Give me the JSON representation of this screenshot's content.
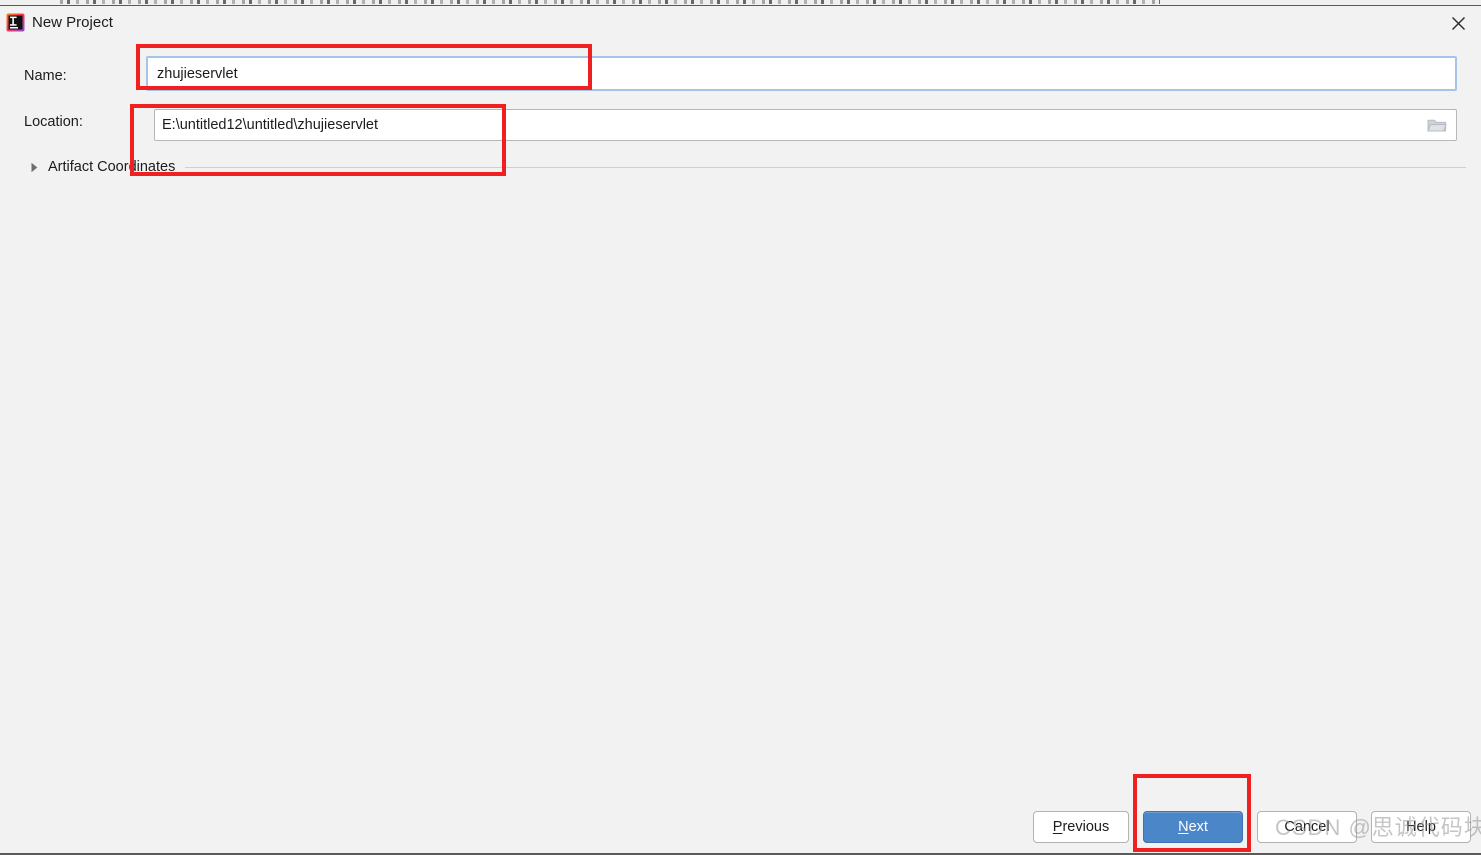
{
  "window": {
    "title": "New Project",
    "icon": "intellij-idea-icon",
    "close_icon": "close-icon"
  },
  "form": {
    "name": {
      "label": "Name:",
      "value": "zhujieservlet",
      "placeholder": "Name"
    },
    "location": {
      "label": "Location:",
      "value": "E:\\untitled12\\untitled\\zhujieservlet",
      "placeholder": "Location",
      "browse_icon": "folder-icon"
    },
    "artifact_coordinates": {
      "label": "Artifact Coordinates",
      "expanded": false,
      "arrow_icon": "chevron-right-icon"
    }
  },
  "footer": {
    "previous_label": "Previous",
    "previous_mnemonic": "P",
    "next_label": "Next",
    "next_mnemonic": "N",
    "cancel_label": "Cancel",
    "help_label": "Help"
  },
  "watermark": {
    "text": "CSDN @思诚代码块"
  },
  "annotations": {
    "accent_color": "#f02020",
    "boxes": [
      {
        "name": "name-field-highlight"
      },
      {
        "name": "location-field-highlight"
      },
      {
        "name": "next-button-highlight"
      }
    ]
  },
  "colors": {
    "dialog_background": "#f2f2f2",
    "default_button": "#4a86c8",
    "focus_border": "#a4c4e8",
    "annotation_red": "#f02020"
  }
}
